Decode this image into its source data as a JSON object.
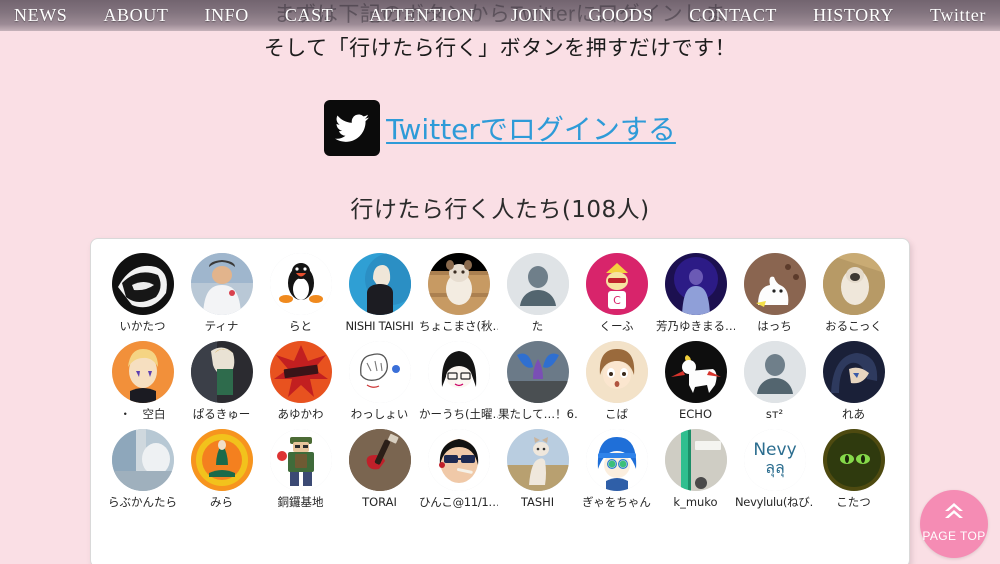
{
  "nav": {
    "items": [
      {
        "label": "NEWS"
      },
      {
        "label": "ABOUT"
      },
      {
        "label": "INFO"
      },
      {
        "label": "CAST"
      },
      {
        "label": "ATTENTION"
      },
      {
        "label": "JOIN"
      },
      {
        "label": "GOODS"
      },
      {
        "label": "CONTACT"
      },
      {
        "label": "HISTORY"
      },
      {
        "label": "Twitter"
      }
    ]
  },
  "background_text": {
    "line1": "まずは下記のボタンからTwitterに口グインしま",
    "line2": "そして「行けたら行く」ボタンを押すだけです！"
  },
  "login": {
    "icon": "twitter-bird-icon",
    "link_label": "Twitterでログインする"
  },
  "list": {
    "heading": "行けたら行く人たち(108人)",
    "count": 108,
    "rows": [
      [
        {
          "name": "いかたつ",
          "avatar": "manga-face"
        },
        {
          "name": "ティナ",
          "avatar": "photo-person-white"
        },
        {
          "name": "らと",
          "avatar": "pingu-penguin"
        },
        {
          "name": "NISHI TAISHI",
          "avatar": "photo-blue-bg"
        },
        {
          "name": "ちょこまさ(秋…",
          "avatar": "plush-toy-wood"
        },
        {
          "name": "た",
          "avatar": "default-silhouette"
        },
        {
          "name": "くーふ",
          "avatar": "pink-character"
        },
        {
          "name": "芳乃ゆきまる…",
          "avatar": "purple-stage"
        },
        {
          "name": "はっち",
          "avatar": "brown-cat-drawing"
        },
        {
          "name": "おるこっく",
          "avatar": "pug-dog-photo"
        }
      ],
      [
        {
          "name": "・　空白",
          "avatar": "orange-anime-girl"
        },
        {
          "name": "ぱるきゅー",
          "avatar": "cosplay-photo"
        },
        {
          "name": "あゆかわ",
          "avatar": "red-burst-logo"
        },
        {
          "name": "わっしょい",
          "avatar": "white-sketch"
        },
        {
          "name": "かーうち(土曜…",
          "avatar": "black-hair-chibi"
        },
        {
          "name": "果たして…！6…",
          "avatar": "blue-wings-cosplay"
        },
        {
          "name": "こば",
          "avatar": "anime-girl-brown"
        },
        {
          "name": "ECHO",
          "avatar": "goat-black-bg"
        },
        {
          "name": "sᴛ²",
          "avatar": "default-silhouette"
        },
        {
          "name": "れあ",
          "avatar": "anime-dark-blue"
        }
      ],
      [
        {
          "name": "らぶかんたら",
          "avatar": "photo-interior"
        },
        {
          "name": "みら",
          "avatar": "orange-circle-emblem"
        },
        {
          "name": "銅鑼基地",
          "avatar": "pixel-man-green"
        },
        {
          "name": "TORAI",
          "avatar": "red-guitar-photo"
        },
        {
          "name": "ひんこ@11/1…",
          "avatar": "bald-sunglasses-illustration"
        },
        {
          "name": "TASHI",
          "avatar": "cat-standing-photo"
        },
        {
          "name": "ぎゃをちゃん",
          "avatar": "blue-hair-anime"
        },
        {
          "name": "k_muko",
          "avatar": "green-object-photo"
        },
        {
          "name": "Nevylulu(ねび…",
          "avatar": "nevy-lulu-text"
        },
        {
          "name": "こたつ",
          "avatar": "green-dark-eyes"
        }
      ]
    ]
  },
  "page_top": {
    "label": "PAGE TOP",
    "icon": "chevron-double-up-icon"
  },
  "colors": {
    "page_background": "#fadfe5",
    "nav_overlay": "#6b5f6b",
    "link_blue": "#2e9bd8",
    "page_top_pink": "#f58cb4",
    "card_white": "#ffffff"
  }
}
